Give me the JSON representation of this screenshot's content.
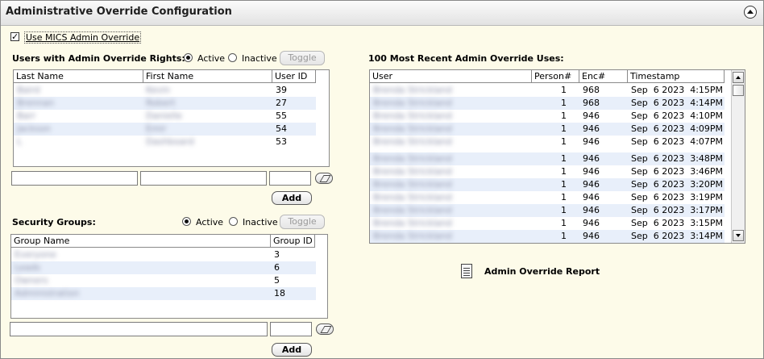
{
  "panel": {
    "title": "Administrative Override Configuration",
    "collapse_icon": "collapse-up-icon"
  },
  "admin_override_checkbox": {
    "label": "Use MICS Admin Override",
    "checked": true
  },
  "users_section": {
    "label": "Users with Admin Override Rights:",
    "radio_active": "Active",
    "radio_inactive": "Inactive",
    "toggle_label": "Toggle",
    "columns": [
      "Last Name",
      "First Name",
      "User ID"
    ],
    "rows": [
      {
        "last": "Baird",
        "first": "Kevin",
        "id": "39"
      },
      {
        "last": "Brennan",
        "first": "Robert",
        "id": "27"
      },
      {
        "last": "Barr",
        "first": "Danielle",
        "id": "55"
      },
      {
        "last": "Jackson",
        "first": "Emir",
        "id": "54"
      },
      {
        "last": "L",
        "first": "Dashboard",
        "id": "53"
      }
    ],
    "add_label": "Add"
  },
  "security_section": {
    "label": "Security Groups:",
    "radio_active": "Active",
    "radio_inactive": "Inactive",
    "toggle_label": "Toggle",
    "columns": [
      "Group Name",
      "Group ID"
    ],
    "rows": [
      {
        "name": "Everyone",
        "id": "3"
      },
      {
        "name": "Leads",
        "id": "6"
      },
      {
        "name": "Owners",
        "id": "5"
      },
      {
        "name": "Administration",
        "id": "18"
      }
    ],
    "add_label": "Add"
  },
  "recent_section": {
    "label": "100 Most Recent Admin Override Uses:",
    "columns": [
      "User",
      "Person#",
      "Enc#",
      "Timestamp"
    ],
    "rows": [
      {
        "user": "Brenda Strickland",
        "person": "1",
        "enc": "968",
        "ts": "Sep  6 2023  4:15PM"
      },
      {
        "user": "Brenda Strickland",
        "person": "1",
        "enc": "968",
        "ts": "Sep  6 2023  4:14PM"
      },
      {
        "user": "Brenda Strickland",
        "person": "1",
        "enc": "946",
        "ts": "Sep  6 2023  4:10PM"
      },
      {
        "user": "Brenda Strickland",
        "person": "1",
        "enc": "946",
        "ts": "Sep  6 2023  4:09PM"
      },
      {
        "user": "Brenda Strickland",
        "person": "1",
        "enc": "946",
        "ts": "Sep  6 2023  4:07PM"
      },
      {
        "user": "Brenda Strickland",
        "person": "1",
        "enc": "946",
        "ts": "Sep  6 2023  3:48PM"
      },
      {
        "user": "Brenda Strickland",
        "person": "1",
        "enc": "946",
        "ts": "Sep  6 2023  3:46PM"
      },
      {
        "user": "Brenda Strickland",
        "person": "1",
        "enc": "946",
        "ts": "Sep  6 2023  3:20PM"
      },
      {
        "user": "Brenda Strickland",
        "person": "1",
        "enc": "946",
        "ts": "Sep  6 2023  3:19PM"
      },
      {
        "user": "Brenda Strickland",
        "person": "1",
        "enc": "946",
        "ts": "Sep  6 2023  3:17PM"
      },
      {
        "user": "Brenda Strickland",
        "person": "1",
        "enc": "946",
        "ts": "Sep  6 2023  3:15PM"
      },
      {
        "user": "Brenda Strickland",
        "person": "1",
        "enc": "946",
        "ts": "Sep  6 2023  3:14PM"
      }
    ]
  },
  "report": {
    "label": "Admin Override Report",
    "icon": "report-icon"
  }
}
